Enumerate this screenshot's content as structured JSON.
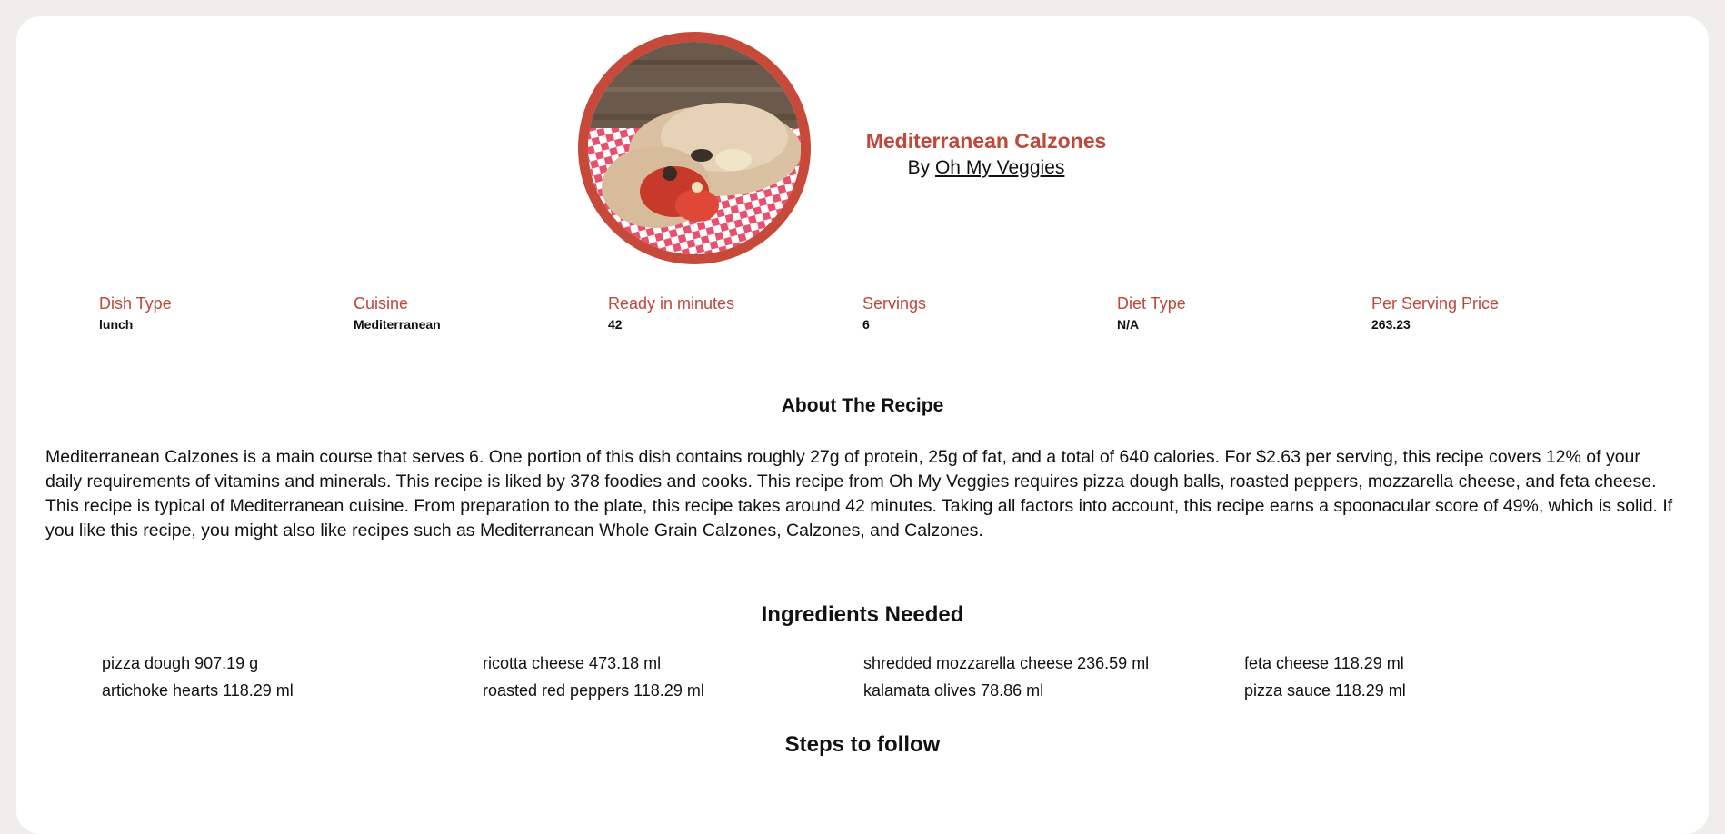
{
  "recipe": {
    "title": "Mediterranean Calzones",
    "by_prefix": "By",
    "author": "Oh My Veggies"
  },
  "facts": [
    {
      "label": "Dish Type",
      "value": "lunch"
    },
    {
      "label": "Cuisine",
      "value": "Mediterranean"
    },
    {
      "label": "Ready in minutes",
      "value": "42"
    },
    {
      "label": "Servings",
      "value": "6"
    },
    {
      "label": "Diet Type",
      "value": "N/A"
    },
    {
      "label": "Per Serving Price",
      "value": "263.23"
    }
  ],
  "about": {
    "heading": "About The Recipe",
    "text": "Mediterranean Calzones is a main course that serves 6. One portion of this dish contains roughly 27g of protein, 25g of fat, and a total of 640 calories. For $2.63 per serving, this recipe covers 12% of your daily requirements of vitamins and minerals. This recipe is liked by 378 foodies and cooks. This recipe from Oh My Veggies requires pizza dough balls, roasted peppers, mozzarella cheese, and feta cheese. This recipe is typical of Mediterranean cuisine. From preparation to the plate, this recipe takes around 42 minutes. Taking all factors into account, this recipe earns a spoonacular score of 49%, which is solid. If you like this recipe, you might also like recipes such as Mediterranean Whole Grain Calzones, Calzones, and Calzones."
  },
  "ingredients": {
    "heading": "Ingredients Needed",
    "items": [
      "pizza dough 907.19 g",
      "ricotta cheese 473.18 ml",
      "shredded mozzarella cheese 236.59 ml",
      "feta cheese 118.29 ml",
      "artichoke hearts 118.29 ml",
      "roasted red peppers 118.29 ml",
      "kalamata olives 78.86 ml",
      "pizza sauce 118.29 ml"
    ]
  },
  "steps": {
    "heading": "Steps to follow"
  },
  "colors": {
    "accent": "#c0473a",
    "page_bg": "#efeeea",
    "card_bg": "#ffffff"
  }
}
